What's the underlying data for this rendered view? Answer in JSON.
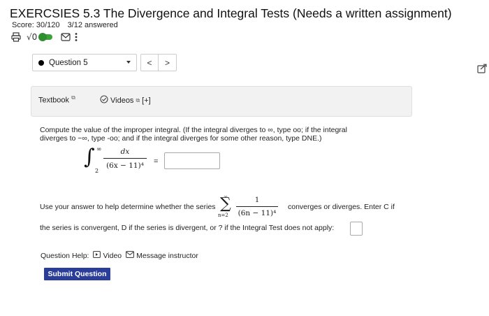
{
  "header": {
    "title": "EXERCSIES 5.3 The Divergence and Integral Tests (Needs a written assignment)",
    "score": "Score: 30/120",
    "answered": "3/12 answered"
  },
  "toolbar": {
    "print_icon": "printer-icon",
    "sqrt_label": "√0",
    "mail_icon": "envelope-icon",
    "more_icon": "vertical-ellipsis-icon"
  },
  "question_nav": {
    "selected": "Question 5",
    "prev": "<",
    "next": ">"
  },
  "resources": {
    "textbook": "Textbook",
    "videos": "Videos",
    "expand": "[+]"
  },
  "prompt": {
    "line1": "Compute the value of the improper integral. (If the integral diverges to ∞, type oo; if the integral",
    "line2": "diverges to −∞, type -oo; and if the integral diverges for some other reason, type DNE.)"
  },
  "integral": {
    "sign": "∫",
    "upper": "∞",
    "lower": "2",
    "numerator": "dx",
    "denominator": "(6x − 11)⁴",
    "equals": "="
  },
  "series": {
    "text_before": "Use your answer to help determine whether the series",
    "sigma": "∑",
    "upper": "∞",
    "lower": "n=2",
    "numerator": "1",
    "denominator": "(6n − 11)⁴",
    "text_after": "converges or diverges. Enter C if",
    "line2": "the series is convergent, D if the series is divergent, or ? if the Integral Test does not apply:"
  },
  "help": {
    "label": "Question Help:",
    "video": "Video",
    "message": "Message instructor"
  },
  "submit_label": "Submit Question",
  "colors": {
    "submit_bg": "#2a3d99",
    "toggle_green": "#3aa33a"
  }
}
